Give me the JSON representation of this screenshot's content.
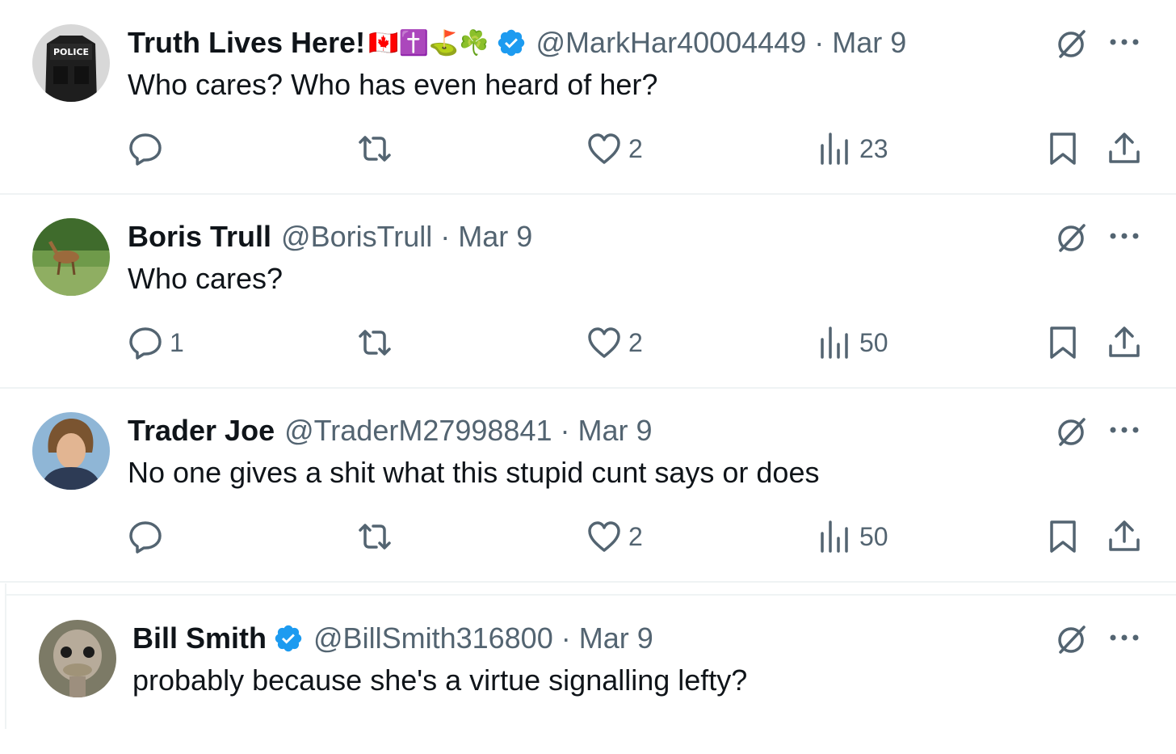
{
  "colors": {
    "text": "#0f1419",
    "muted": "#536471",
    "verified": "#1d9bf0",
    "divider": "#eff3f4"
  },
  "posts": [
    {
      "display_name": "Truth Lives Here!",
      "name_emojis": "🇨🇦✝️⛳☘️",
      "verified": true,
      "handle": "@MarkHar40004449",
      "separator": "·",
      "date": "Mar 9",
      "text": "Who cares? Who has even heard of her?",
      "replies": "",
      "reposts": "",
      "likes": "2",
      "views": "23",
      "avatar_icon": "police-vest-avatar"
    },
    {
      "display_name": "Boris Trull",
      "name_emojis": "",
      "verified": false,
      "handle": "@BorisTrull",
      "separator": "·",
      "date": "Mar 9",
      "text": "Who cares?",
      "replies": "1",
      "reposts": "",
      "likes": "2",
      "views": "50",
      "avatar_icon": "deer-avatar"
    },
    {
      "display_name": "Trader Joe",
      "name_emojis": "",
      "verified": false,
      "handle": "@TraderM27998841",
      "separator": "·",
      "date": "Mar 9",
      "text": "No one gives a shit what this stupid cunt says or does",
      "replies": "",
      "reposts": "",
      "likes": "2",
      "views": "50",
      "avatar_icon": "man-portrait-avatar"
    },
    {
      "display_name": "Bill Smith",
      "name_emojis": "",
      "verified": true,
      "handle": "@BillSmith316800",
      "separator": "·",
      "date": "Mar 9",
      "text": "probably because she's a virtue signalling lefty?",
      "avatar_icon": "ostrich-avatar"
    }
  ]
}
